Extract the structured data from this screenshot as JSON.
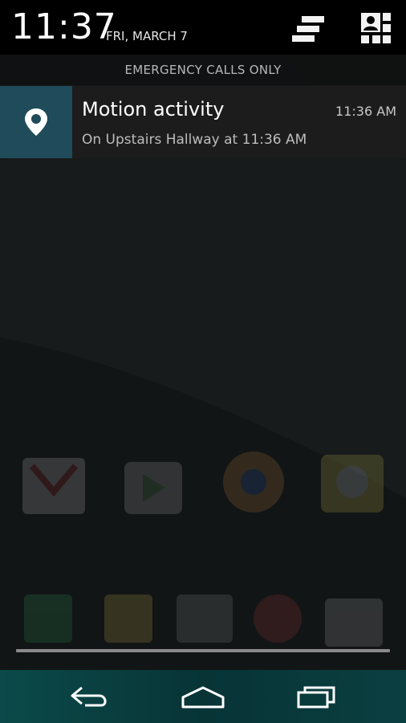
{
  "status": {
    "time": "11:37",
    "date": "FRI, MARCH 7"
  },
  "carrier": {
    "text": "EMERGENCY CALLS ONLY"
  },
  "notification": {
    "title": "Motion activity",
    "time": "11:36 AM",
    "text": "On Upstairs Hallway at 11:36 AM",
    "icon": "location-pin-icon",
    "icon_bg": "#1f4b5a"
  },
  "header_icons": {
    "clear": "clear-all-icon",
    "settings": "quick-settings-icon"
  },
  "nav": {
    "back": "back-icon",
    "home": "home-icon",
    "recents": "recents-icon"
  },
  "colors": {
    "nav_accent": "#0b4a4a"
  }
}
